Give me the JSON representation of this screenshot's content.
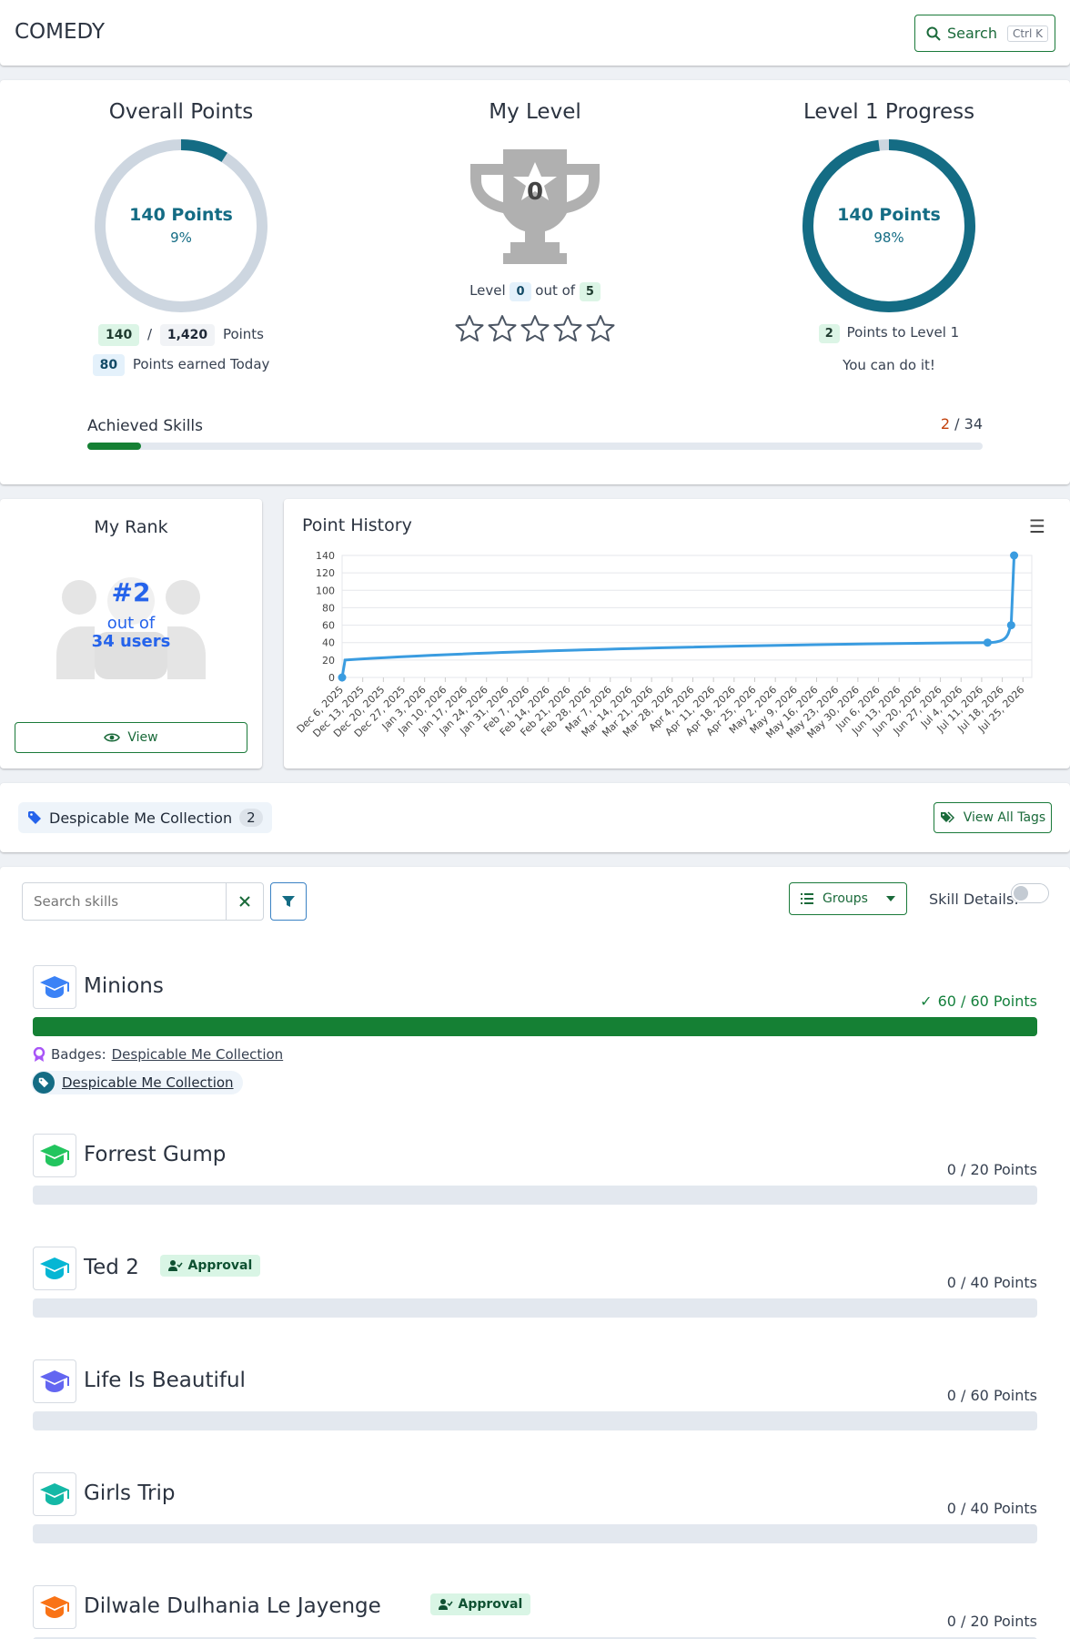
{
  "header": {
    "title": "COMEDY",
    "search_label": "Search",
    "search_shortcut": "Ctrl K"
  },
  "overall": {
    "title": "Overall Points",
    "points_label": "140 Points",
    "percent_label": "9%",
    "percent": 9,
    "earned": "140",
    "sep": "/",
    "total": "1,420",
    "points_word": "Points",
    "today": "80",
    "today_label": "Points earned Today"
  },
  "level": {
    "title": "My Level",
    "trophy_level": "0",
    "level_word": "Level",
    "level_value": "0",
    "out_of": "out of",
    "max_level": "5",
    "stars_filled": 0,
    "stars_total": 5
  },
  "progress": {
    "title": "Level 1 Progress",
    "points_label": "140 Points",
    "percent_label": "98%",
    "percent": 98,
    "remaining": "2",
    "remaining_label": "Points to Level 1",
    "encouragement": "You can do it!"
  },
  "achieved": {
    "label": "Achieved Skills",
    "count": "2",
    "total": "/ 34",
    "fraction": 0.06
  },
  "rank": {
    "title": "My Rank",
    "position": "#2",
    "out_of": "out of",
    "users": "34 users",
    "view_label": "View"
  },
  "chart_data": {
    "type": "line",
    "title": "Point History",
    "xlabel": "",
    "ylabel": "",
    "ylim": [
      0,
      140
    ],
    "yticks": [
      0,
      20,
      40,
      60,
      80,
      100,
      120,
      140
    ],
    "xticks": [
      "Dec 6, 2025",
      "Dec 13, 2025",
      "Dec 20, 2025",
      "Dec 27, 2025",
      "Jan 3, 2026",
      "Jan 10, 2026",
      "Jan 17, 2026",
      "Jan 24, 2026",
      "Jan 31, 2026",
      "Feb 7, 2026",
      "Feb 14, 2026",
      "Feb 21, 2026",
      "Feb 28, 2026",
      "Mar 7, 2026",
      "Mar 14, 2026",
      "Mar 21, 2026",
      "Mar 28, 2026",
      "Apr 4, 2026",
      "Apr 11, 2026",
      "Apr 18, 2026",
      "Apr 25, 2026",
      "May 2, 2026",
      "May 9, 2026",
      "May 16, 2026",
      "May 23, 2026",
      "May 30, 2026",
      "Jun 6, 2026",
      "Jun 13, 2026",
      "Jun 20, 2026",
      "Jun 27, 2026",
      "Jul 4, 2026",
      "Jul 11, 2026",
      "Jul 18, 2026",
      "Jul 25, 2026"
    ],
    "series": [
      {
        "color": "#3a9ce0",
        "points": [
          [
            "Dec 6, 2025",
            0
          ],
          [
            "Dec 7, 2025",
            20
          ],
          [
            "Jul 13, 2026",
            40
          ],
          [
            "Jul 21, 2026",
            60
          ],
          [
            "Jul 22, 2026",
            140
          ]
        ]
      }
    ],
    "grid": true
  },
  "tags_bar": {
    "tag_label": "Despicable Me Collection",
    "tag_count": "2",
    "view_all_label": "View All Tags"
  },
  "filters": {
    "search_placeholder": "Search skills",
    "groups_label": "Groups",
    "details_label": "Skill Details:"
  },
  "skills": [
    {
      "name": "Minions",
      "points": "60 / 60 Points",
      "fraction": 1.0,
      "color": "#3b82f6",
      "completed": true,
      "badges_label": "Badges:",
      "badge": "Despicable Me Collection",
      "tag": "Despicable Me Collection"
    },
    {
      "name": "Forrest Gump",
      "points": "0 / 20 Points",
      "fraction": 0,
      "color": "#22c55e"
    },
    {
      "name": "Ted 2",
      "points": "0 / 40 Points",
      "fraction": 0,
      "color": "#06b6d4",
      "approval": "Approval"
    },
    {
      "name": "Life Is Beautiful",
      "points": "0 / 60 Points",
      "fraction": 0,
      "color": "#6366f1"
    },
    {
      "name": "Girls Trip",
      "points": "0 / 40 Points",
      "fraction": 0,
      "color": "#14b8a6"
    },
    {
      "name": "Dilwale Dulhania Le Jayenge",
      "points": "0 / 20 Points",
      "fraction": 0,
      "color": "#f97316",
      "approval": "Approval"
    }
  ]
}
